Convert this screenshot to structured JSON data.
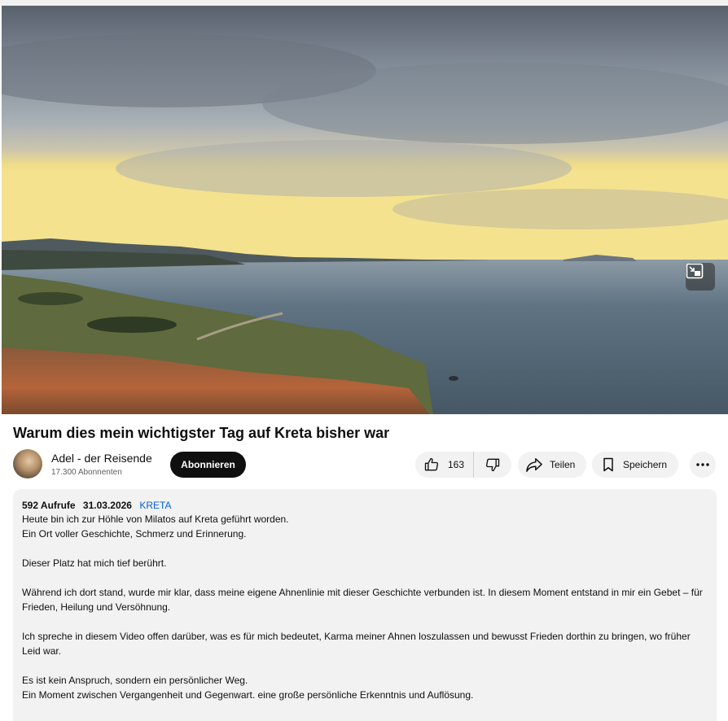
{
  "video": {
    "title": "Warum dies mein wichtigster Tag auf Kreta bisher war"
  },
  "channel": {
    "name": "Adel - der Reisende",
    "subscribers": "17.300 Abonnenten",
    "subscribe_label": "Abonnieren"
  },
  "actions": {
    "like_count": "163",
    "share_label": "Teilen",
    "save_label": "Speichern"
  },
  "description": {
    "views": "592 Aufrufe",
    "date": "31.03.2026",
    "hashtag": "KRETA",
    "lines": [
      "Heute bin ich zur Höhle von Milatos auf Kreta geführt worden.",
      "Ein Ort voller Geschichte, Schmerz und Erinnerung.",
      "Dieser Platz hat mich tief berührt.",
      "Während ich dort stand, wurde mir klar, dass meine eigene Ahnenlinie mit dieser Geschichte verbunden ist. In diesem Moment entstand in mir ein Gebet – für Frieden, Heilung und Versöhnung.",
      "Ich spreche in diesem Video offen darüber, was es für mich bedeutet, Karma meiner Ahnen loszulassen und bewusst Frieden dorthin zu bringen, wo früher Leid war.",
      "Es ist kein Anspruch, sondern ein persönlicher Weg.",
      "Ein Moment zwischen Vergangenheit und Gegenwart. eine große persönliche Erkenntnis und Auflösung."
    ]
  },
  "colors": {
    "subscribe_bg": "#0f0f0f",
    "pill_bg": "#f2f2f2",
    "hashtag": "#065fd4"
  },
  "icons": [
    "picture-in-picture-icon",
    "thumbs-up-icon",
    "thumbs-down-icon",
    "share-icon",
    "bookmark-icon",
    "more-icon"
  ]
}
